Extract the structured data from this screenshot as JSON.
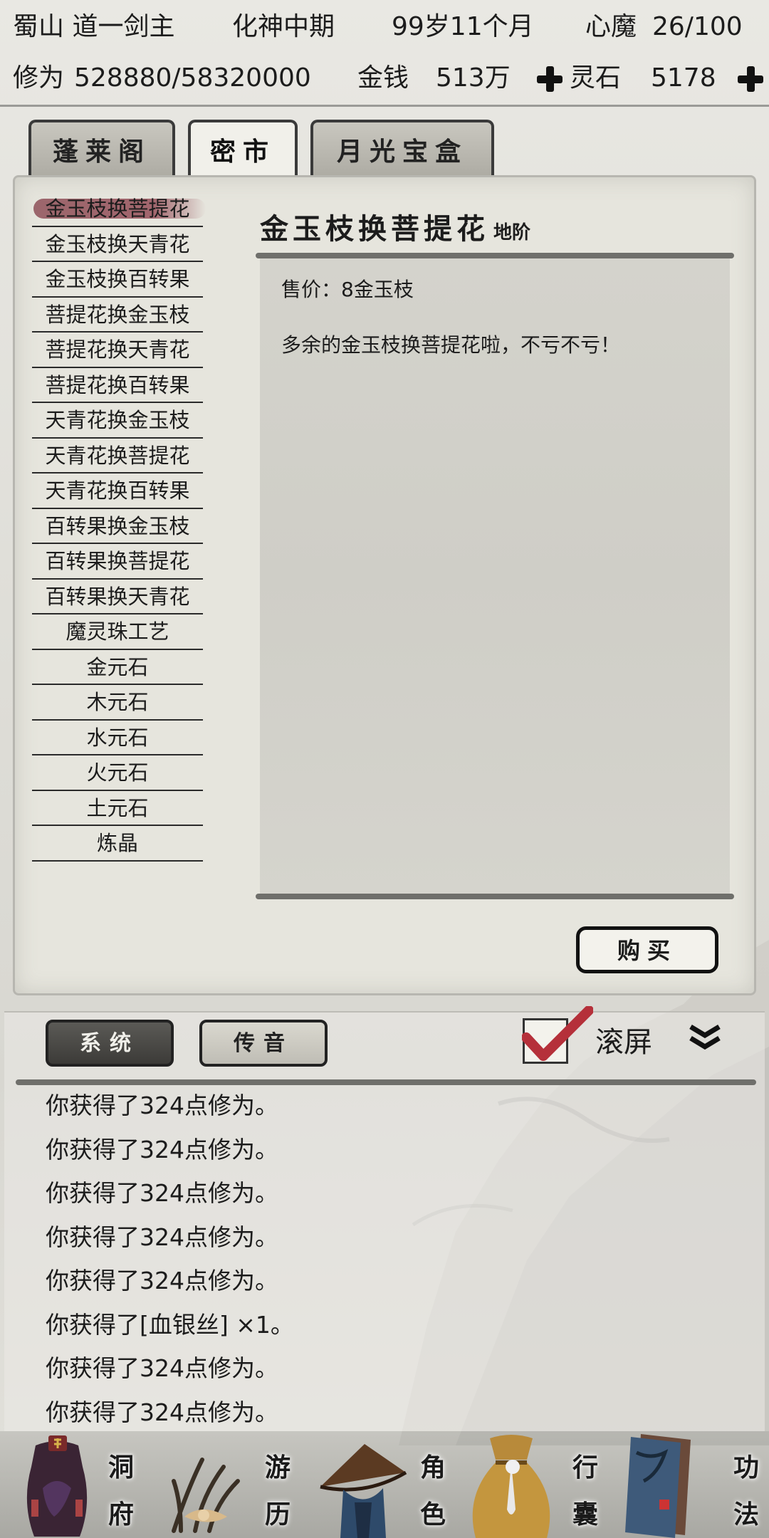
{
  "status": {
    "name": "蜀山 道一剑主",
    "realm": "化神中期",
    "age": "99岁11个月",
    "demon_label": "心魔",
    "demon_value": "26/100",
    "cultivation_label": "修为",
    "cultivation_value": "528880/58320000",
    "money_label": "金钱",
    "money_value": "513万",
    "stone_label": "灵石",
    "stone_value": "5178"
  },
  "shop": {
    "tabs": [
      {
        "label": "蓬莱阁",
        "active": false
      },
      {
        "label": "密市",
        "active": true
      },
      {
        "label": "月光宝盒",
        "active": false
      }
    ],
    "items": [
      "金玉枝换菩提花",
      "金玉枝换天青花",
      "金玉枝换百转果",
      "菩提花换金玉枝",
      "菩提花换天青花",
      "菩提花换百转果",
      "天青花换金玉枝",
      "天青花换菩提花",
      "天青花换百转果",
      "百转果换金玉枝",
      "百转果换菩提花",
      "百转果换天青花",
      "魔灵珠工艺",
      "金元石",
      "木元石",
      "水元石",
      "火元石",
      "土元石",
      "炼晶"
    ],
    "selected_index": 0,
    "detail": {
      "name": "金玉枝换菩提花",
      "grade": "地阶",
      "price": "售价：8金玉枝",
      "description": "多余的金玉枝换菩提花啦，不亏不亏！"
    },
    "buy_label": "购买"
  },
  "log": {
    "tabs": [
      {
        "label": "系统",
        "active": true
      },
      {
        "label": "传音",
        "active": false
      }
    ],
    "scroll_label": "滚屏",
    "scroll_checked": true,
    "lines": [
      "你获得了324点修为。",
      "你获得了324点修为。",
      "你获得了324点修为。",
      "你获得了324点修为。",
      "你获得了324点修为。",
      "你获得了[血银丝] ×1。",
      "你获得了324点修为。",
      "你获得了324点修为。"
    ]
  },
  "nav": [
    {
      "chars": [
        "洞",
        "府"
      ],
      "icon": "cave-dwelling-icon"
    },
    {
      "chars": [
        "游",
        "历"
      ],
      "icon": "travel-icon"
    },
    {
      "chars": [
        "角",
        "色"
      ],
      "icon": "character-hat-icon"
    },
    {
      "chars": [
        "行",
        "囊"
      ],
      "icon": "bag-icon"
    },
    {
      "chars": [
        "功",
        "法"
      ],
      "icon": "scripture-books-icon"
    }
  ],
  "colors": {
    "selected_highlight": "#8c4a55",
    "checkmark": "#b5303a",
    "ink": "#1c1c1c"
  }
}
